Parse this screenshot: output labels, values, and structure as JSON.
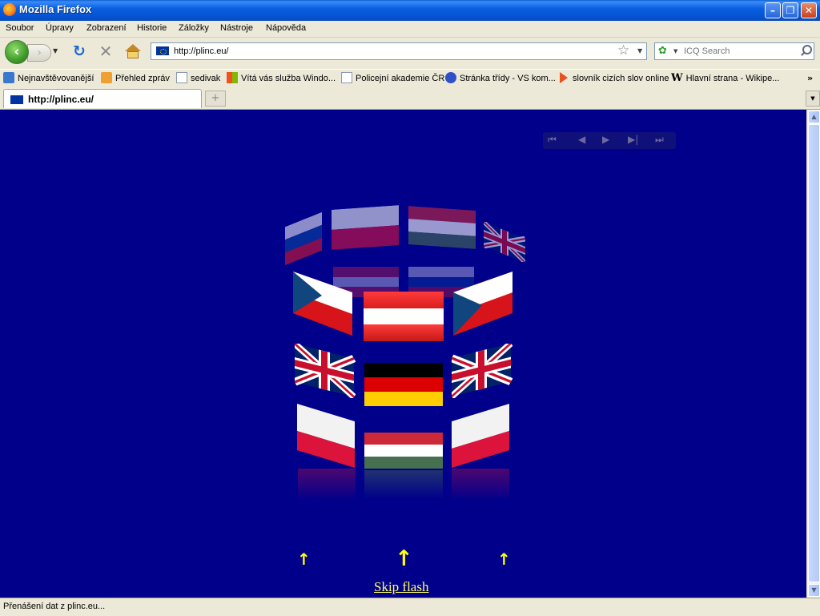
{
  "window": {
    "title": "Mozilla Firefox",
    "controls": {
      "minimize": "–",
      "maximize": "❐",
      "close": "✕"
    }
  },
  "menu": [
    "Soubor",
    "Úpravy",
    "Zobrazení",
    "Historie",
    "Záložky",
    "Nástroje",
    "Nápověda"
  ],
  "nav": {
    "url": "http://plinc.eu/",
    "search_placeholder": "ICQ Search",
    "back_icon": "back-arrow-icon",
    "forward_icon": "forward-arrow-icon",
    "reload_icon": "reload-icon",
    "stop_icon": "stop-icon",
    "home_icon": "home-icon"
  },
  "bookmarks": [
    {
      "label": "Nejnavštěvovanější",
      "icon": "magnifier-icon"
    },
    {
      "label": "Přehled zpráv",
      "icon": "rss-icon"
    },
    {
      "label": "sedivak",
      "icon": "page-icon"
    },
    {
      "label": "Vítá vás služba Windo...",
      "icon": "windows-icon"
    },
    {
      "label": "Policejní akademie ČR",
      "icon": "page-icon"
    },
    {
      "label": "Stránka třídy - VS kom...",
      "icon": "gear-icon"
    },
    {
      "label": "slovník cizích slov online",
      "icon": "arrow-icon"
    },
    {
      "label": "Hlavní strana - Wikipe...",
      "icon": "wikipedia-icon"
    }
  ],
  "bookmarks_more": "»",
  "tab": {
    "label": "http://plinc.eu/",
    "new_tab": "+"
  },
  "content": {
    "background": "#00008b",
    "player_controls": [
      "⏮",
      "◀",
      "▶",
      "▶|",
      "⏭"
    ],
    "skip_link": "Skip flash",
    "arrow_glyph": "↑",
    "arrow_color": "#ffff00"
  },
  "status": "Přenášení dat z plinc.eu..."
}
